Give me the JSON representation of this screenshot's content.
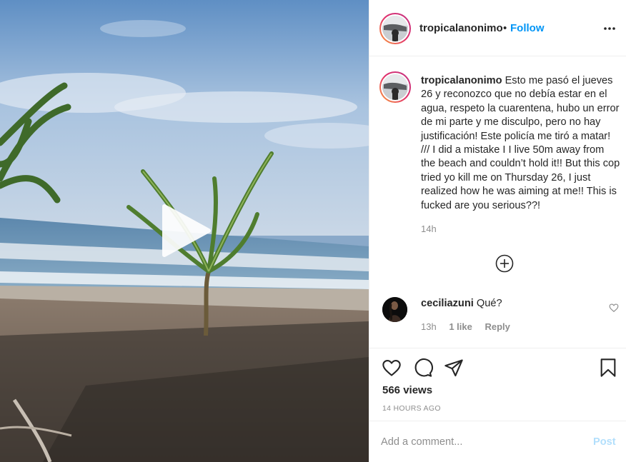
{
  "header": {
    "username": "tropicalanonimo",
    "separator": "•",
    "follow_label": "Follow",
    "more_icon": "more-horizontal-icon"
  },
  "caption": {
    "username": "tropicalanonimo",
    "text": "Esto me pasó el jueves 26 y reconozco que no debía estar en el agua, respeto la cuarentena, hubo un error de mi parte y me disculpo, pero no hay justificación! Este policía me tiró a matar! /// I did a mistake I I live 50m away from the beach and couldn’t hold it!! But this cop tried yo kill me on Thursday 26, I just realized how he was aiming at me!! This is fucked are you serious??!",
    "time": "14h"
  },
  "load_more_icon": "plus-circle-icon",
  "comment": {
    "username": "ceciliazuni",
    "text": "Qué?",
    "time": "13h",
    "likes": "1 like",
    "reply_label": "Reply"
  },
  "actions": {
    "icons": [
      "heart-icon",
      "comment-icon",
      "share-icon",
      "bookmark-icon"
    ],
    "views": "566 views",
    "posted": "14 HOURS AGO"
  },
  "add_comment": {
    "placeholder": "Add a comment...",
    "post_label": "Post"
  },
  "colors": {
    "accent": "#0095f6",
    "post_disabled": "#b2dffc",
    "muted": "#8e8e8e",
    "text": "#262626"
  },
  "media": {
    "play_icon": "play-icon"
  }
}
